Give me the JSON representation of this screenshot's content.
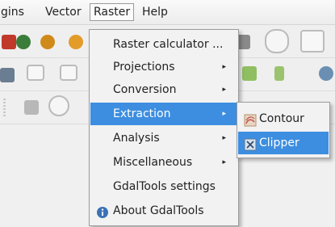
{
  "menubar": {
    "items": [
      {
        "label": "gins"
      },
      {
        "label": "Vector"
      },
      {
        "label": "Raster"
      },
      {
        "label": "Help"
      }
    ]
  },
  "raster_menu": {
    "items": [
      {
        "label": "Raster calculator ...",
        "submenu": false
      },
      {
        "label": "Projections",
        "submenu": true,
        "arrow": "▸"
      },
      {
        "label": "Conversion",
        "submenu": true,
        "arrow": "▸"
      },
      {
        "label": "Extraction",
        "submenu": true,
        "arrow": "▸",
        "highlighted": true
      },
      {
        "label": "Analysis",
        "submenu": true,
        "arrow": "▸"
      },
      {
        "label": "Miscellaneous",
        "submenu": true,
        "arrow": "▸"
      },
      {
        "label": "GdalTools settings",
        "submenu": false
      },
      {
        "label": "About GdalTools",
        "submenu": false,
        "icon": "about-info-icon"
      }
    ]
  },
  "extraction_submenu": {
    "items": [
      {
        "label": "Contour",
        "icon": "contour-icon"
      },
      {
        "label": "Clipper",
        "icon": "clipper-icon",
        "highlighted": true
      }
    ]
  },
  "colors": {
    "highlight": "#3d8ee0",
    "menu_bg": "#f2f2f2"
  }
}
